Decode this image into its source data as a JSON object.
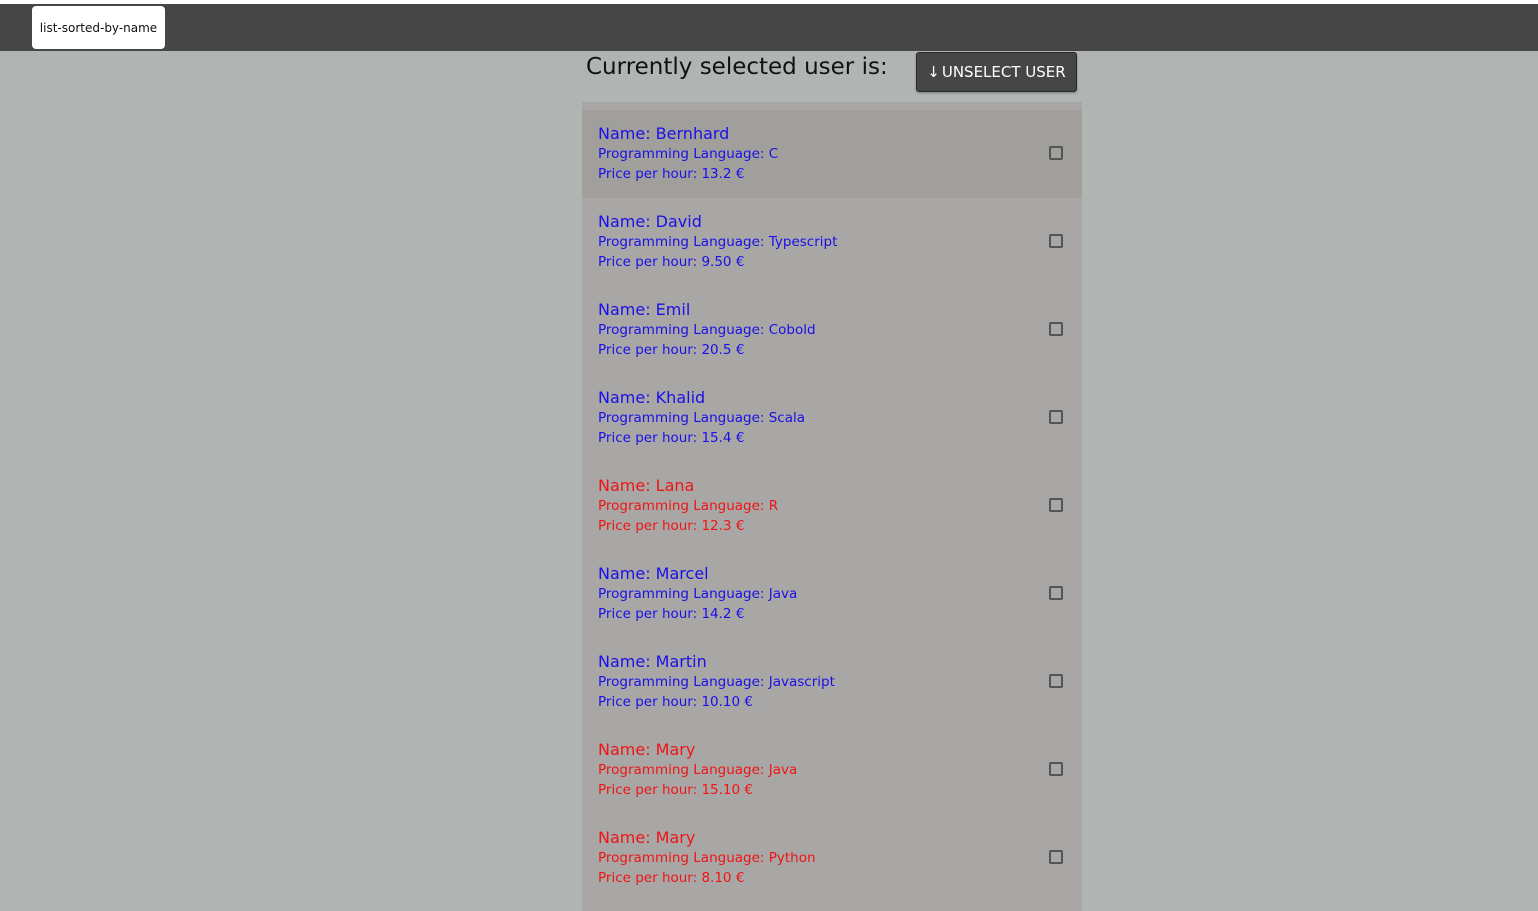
{
  "tabs": [
    {
      "label": "list-sorted-by-name"
    }
  ],
  "header": {
    "title": "Currently selected user is:",
    "unselect_button": {
      "arrow": "↓",
      "label": "UNSELECT USER"
    }
  },
  "colors": {
    "available": "#1a10e8",
    "unavailable": "#f01414"
  },
  "users": [
    {
      "name": "Name: Bernhard",
      "language": "Programming Language: C",
      "price": "Price per hour: 13.2 €",
      "color": "#1a10e8",
      "checked": false
    },
    {
      "name": "Name: David",
      "language": "Programming Language: Typescript",
      "price": "Price per hour: 9.50 €",
      "color": "#1a10e8",
      "checked": false
    },
    {
      "name": "Name: Emil",
      "language": "Programming Language: Cobold",
      "price": "Price per hour: 20.5 €",
      "color": "#1a10e8",
      "checked": false
    },
    {
      "name": "Name: Khalid",
      "language": "Programming Language: Scala",
      "price": "Price per hour: 15.4 €",
      "color": "#1a10e8",
      "checked": false
    },
    {
      "name": "Name: Lana",
      "language": "Programming Language: R",
      "price": "Price per hour: 12.3 €",
      "color": "#f01414",
      "checked": false
    },
    {
      "name": "Name: Marcel",
      "language": "Programming Language: Java",
      "price": "Price per hour: 14.2 €",
      "color": "#1a10e8",
      "checked": false
    },
    {
      "name": "Name: Martin",
      "language": "Programming Language: Javascript",
      "price": "Price per hour: 10.10 €",
      "color": "#1a10e8",
      "checked": false
    },
    {
      "name": "Name: Mary",
      "language": "Programming Language: Java",
      "price": "Price per hour: 15.10 €",
      "color": "#f01414",
      "checked": false
    },
    {
      "name": "Name: Mary",
      "language": "Programming Language: Python",
      "price": "Price per hour: 8.10 €",
      "color": "#f01414",
      "checked": false
    }
  ]
}
